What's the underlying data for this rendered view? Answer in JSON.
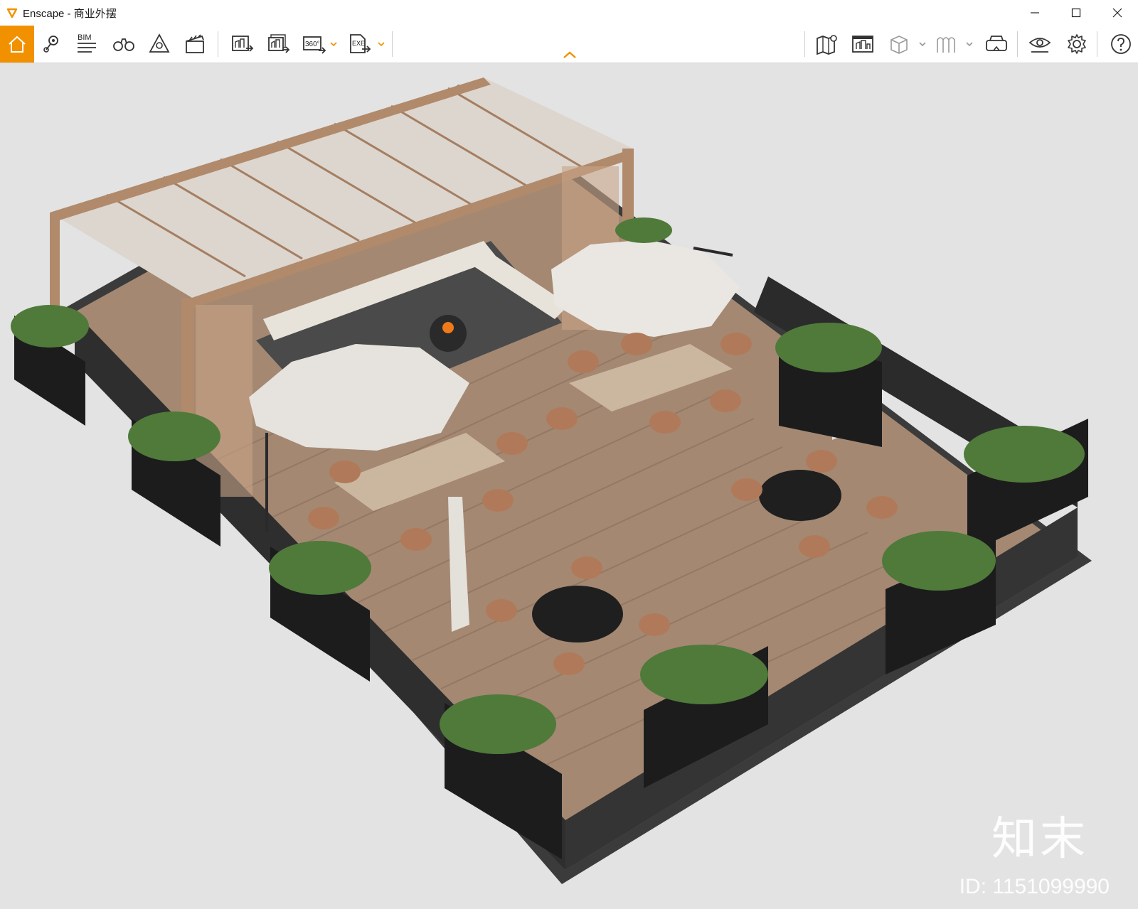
{
  "window": {
    "title": "Enscape - 商业外摆",
    "controls": [
      "minimize-icon",
      "maximize-icon",
      "close-icon"
    ]
  },
  "toolbar": {
    "accent_color": "#f29100",
    "bim_label": "BIM",
    "panorama_label": "360°",
    "exe_label": "EXE",
    "left_tools": [
      "home-icon",
      "location-pin-icon",
      "bim-icon",
      "binoculars-icon",
      "visual-settings-icon",
      "clapperboard-icon"
    ],
    "export_tools": [
      "screenshot-export-icon",
      "batch-render-icon",
      "panorama-360-icon",
      "exe-export-icon"
    ],
    "right_tools": [
      "map-icon",
      "collaborative-annotation-icon",
      "cube-view-icon",
      "asset-library-icon",
      "vr-headset-icon",
      "view-eye-icon",
      "settings-gear-icon",
      "help-icon"
    ]
  },
  "watermark": {
    "brand": "知末",
    "id_text": "ID: 1151099990"
  }
}
